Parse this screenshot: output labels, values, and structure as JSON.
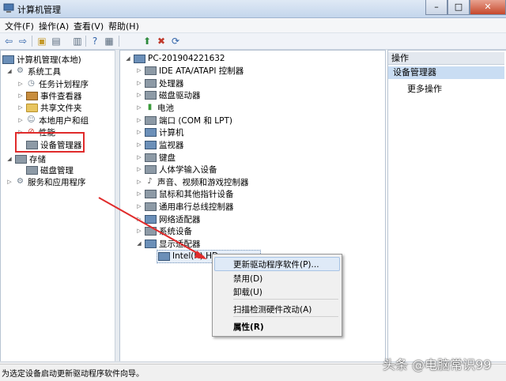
{
  "window": {
    "title": "计算机管理",
    "buttons": [
      "–",
      "□",
      "✕"
    ]
  },
  "menu": [
    "文件(F)",
    "操作(A)",
    "查看(V)",
    "帮助(H)"
  ],
  "toolbar": {
    "icons": [
      "back-icon",
      "forward-icon",
      "up-folder-icon",
      "console-tree-icon",
      "properties-icon",
      "help-icon",
      "view-icon",
      "update-driver-icon",
      "uninstall-icon",
      "scan-hardware-icon"
    ]
  },
  "left_tree": {
    "root": "计算机管理(本地)",
    "items": [
      {
        "label": "系统工具",
        "level": 1
      },
      {
        "label": "任务计划程序",
        "level": 2
      },
      {
        "label": "事件查看器",
        "level": 2
      },
      {
        "label": "共享文件夹",
        "level": 2
      },
      {
        "label": "本地用户和组",
        "level": 2
      },
      {
        "label": "性能",
        "level": 2
      },
      {
        "label": "设备管理器",
        "level": 2
      },
      {
        "label": "存储",
        "level": 1
      },
      {
        "label": "磁盘管理",
        "level": 2
      },
      {
        "label": "服务和应用程序",
        "level": 1
      }
    ]
  },
  "device_tree": {
    "computer": "PC-201904221632",
    "categories": [
      "IDE ATA/ATAPI 控制器",
      "处理器",
      "磁盘驱动器",
      "电池",
      "端口 (COM 和 LPT)",
      "计算机",
      "监视器",
      "键盘",
      "人体学输入设备",
      "声音、视频和游戏控制器",
      "鼠标和其他指针设备",
      "通用串行总线控制器",
      "网络适配器",
      "系统设备",
      "显示适配器"
    ],
    "selected_device": "Intel(R) HD"
  },
  "actions": {
    "header": "操作",
    "selected": "设备管理器",
    "more": "更多操作"
  },
  "context_menu": {
    "update": "更新驱动程序软件(P)...",
    "disable": "禁用(D)",
    "uninstall": "卸载(U)",
    "scan": "扫描检测硬件改动(A)",
    "properties": "属性(R)"
  },
  "status": "为选定设备启动更新驱动程序软件向导。",
  "watermark": "头条 @电脑常识99",
  "colors": {
    "highlight_box": "#e02b2b",
    "arrow": "#e02b2b",
    "accent": "#c9ddf3"
  }
}
